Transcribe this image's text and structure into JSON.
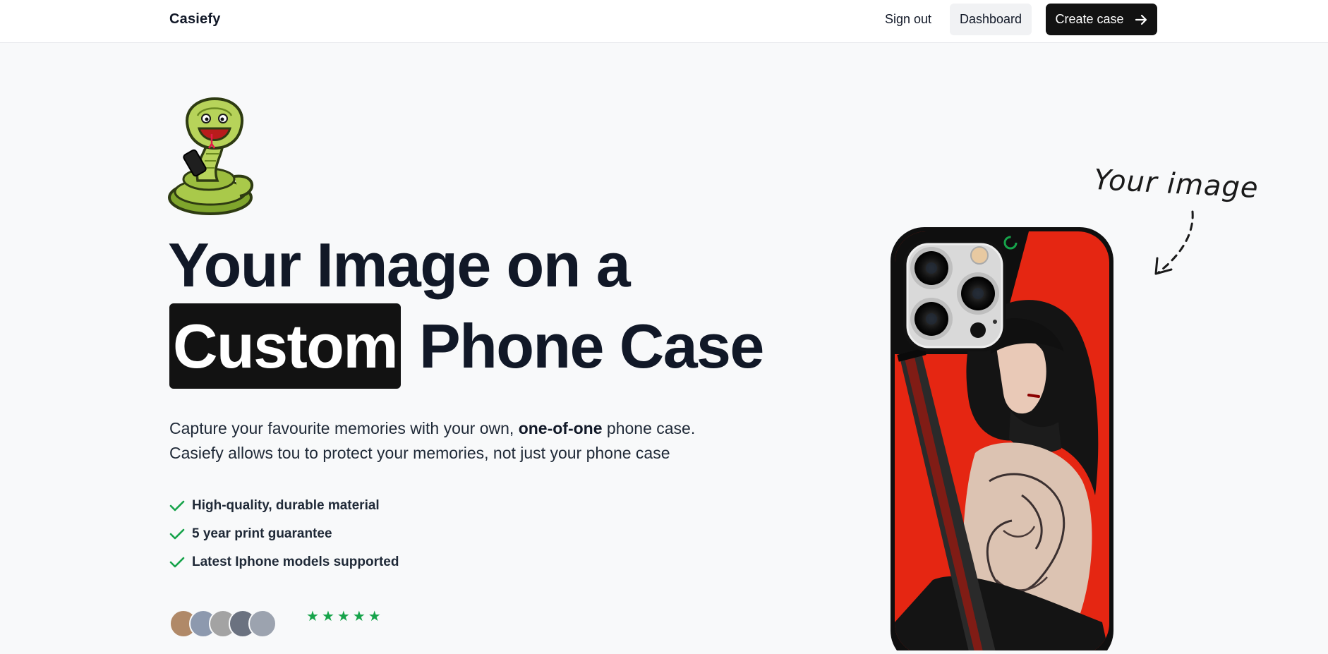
{
  "nav": {
    "brand": "Casiefy",
    "sign_out": "Sign out",
    "dashboard": "Dashboard",
    "create_case": "Create case",
    "create_icon": "arrow-right-icon"
  },
  "hero": {
    "mascot_icon": "snake-mascot",
    "headline_line1": "Your Image on a",
    "headline_highlight": "Custom",
    "headline_rest": "Phone Case",
    "subtext_part1": "Capture your favourite memories with your own,",
    "subtext_bold": "one-of-one",
    "subtext_part2": "phone case.",
    "subtext_line2": "Casiefy allows tou to protect your memories, not just your phone case",
    "features": [
      "High-quality, durable material",
      "5 year print guarantee",
      "Latest Iphone models supported"
    ],
    "feature_icon": "check-icon",
    "star_icon": "star-icon"
  },
  "phone_preview": {
    "annotation": "Your image",
    "colors": {
      "case_frame": "#0f0f0f",
      "background_red": "#e52612",
      "camera_plate": "#d9d9d9",
      "accent_green": "#16a34a"
    }
  }
}
